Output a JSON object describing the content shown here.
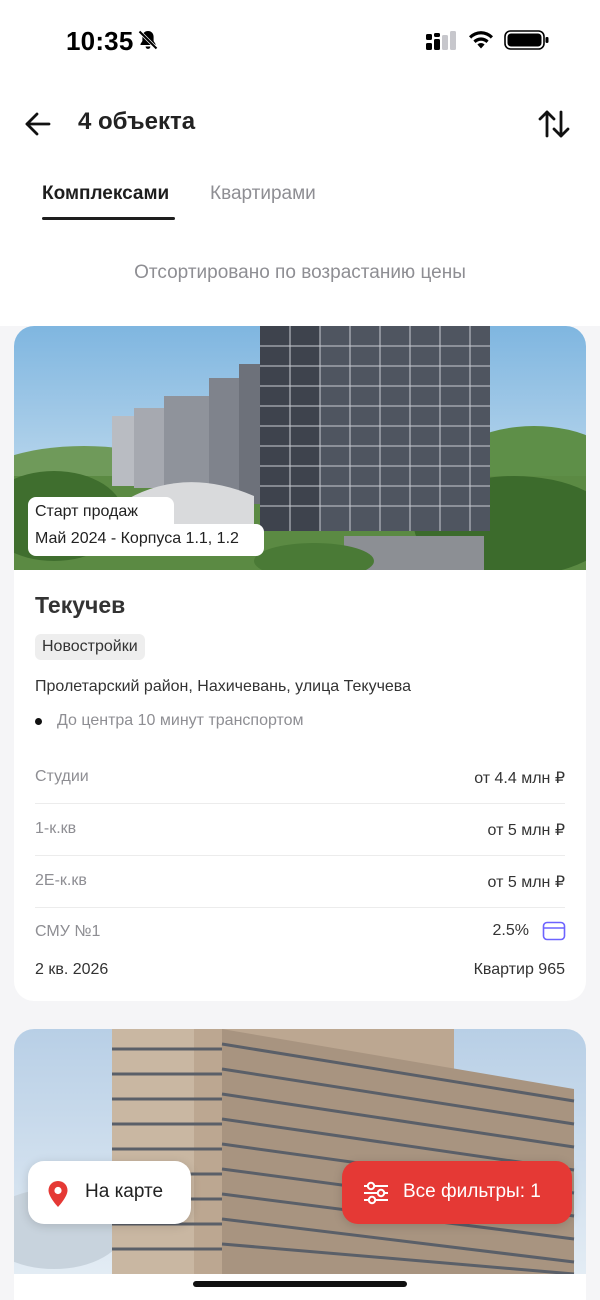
{
  "status_bar": {
    "time": "10:35"
  },
  "header": {
    "title": "4 объекта"
  },
  "tabs": [
    {
      "label": "Комплексами",
      "active": true
    },
    {
      "label": "Квартирами",
      "active": false
    }
  ],
  "sort_note": "Отсортировано по возрастанию цены",
  "cards": [
    {
      "sale_start_label": "Старт продаж",
      "sale_start_value": "Май 2024 - Корпуса 1.1, 1.2",
      "name": "Текучев",
      "category": "Новостройки",
      "address": "Пролетарский район, Нахичевань, улица Текучева",
      "transport": "До центра 10 минут транспортом",
      "prices": [
        {
          "label": "Студии",
          "value": "от 4.4 млн ₽"
        },
        {
          "label": "1-к.кв",
          "value": "от 5 млн ₽"
        },
        {
          "label": "2Е-к.кв",
          "value": "от 5 млн ₽"
        }
      ],
      "developer": "СМУ №1",
      "mortgage_rate": "2.5%",
      "completion": "2 кв. 2026",
      "apartments": "Квартир 965"
    }
  ],
  "actions": {
    "map_label": "На карте",
    "filters_label": "Все фильтры: 1"
  },
  "colors": {
    "accent_red": "#e53935",
    "text_primary": "#222222",
    "text_secondary": "#8e8e93",
    "card_icon": "#6c63ff"
  }
}
